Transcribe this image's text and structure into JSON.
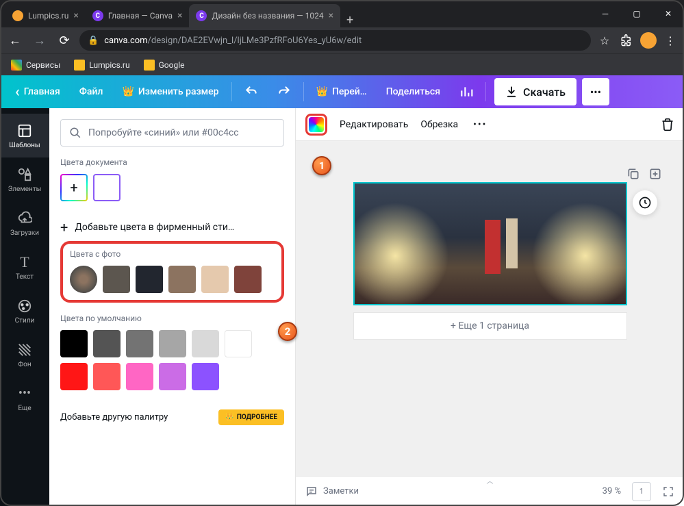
{
  "browser": {
    "tabs": [
      {
        "title": "Lumpics.ru",
        "favicon_color": "#f7a334"
      },
      {
        "title": "Главная — Canva",
        "favicon_bg": "#7c3aed",
        "favicon_text": "C"
      },
      {
        "title": "Дизайн без названия — 1024",
        "favicon_bg": "#7c3aed",
        "favicon_text": "C",
        "active": true
      }
    ],
    "url": {
      "lock": "🔒",
      "host": "canva.com",
      "path": "/design/DAE2EVwjn_l/ljLMe3PzfRFoU6Yes_yU6w/edit"
    },
    "bookmarks": [
      {
        "label": "Сервисы",
        "icon_html": "⋮⋮⋮"
      },
      {
        "label": "Lumpics.ru",
        "icon_color": "#fbbf24"
      },
      {
        "label": "Google",
        "icon_color": "#fbbf24"
      }
    ]
  },
  "topbar": {
    "back": "‹",
    "home": "Главная",
    "file": "Файл",
    "resize": "Изменить размер",
    "upgrade": "Перей…",
    "share": "Поделиться",
    "download": "Скачать"
  },
  "sidebar": [
    {
      "label": "Шаблоны",
      "icon": "templates",
      "active": true
    },
    {
      "label": "Элементы",
      "icon": "elements"
    },
    {
      "label": "Загрузки",
      "icon": "uploads"
    },
    {
      "label": "Текст",
      "icon": "text"
    },
    {
      "label": "Стили",
      "icon": "styles"
    },
    {
      "label": "Фон",
      "icon": "background"
    },
    {
      "label": "Еще",
      "icon": "more"
    }
  ],
  "color_panel": {
    "search_placeholder": "Попробуйте «синий» или #00c4cc",
    "doc_colors_label": "Цвета документа",
    "brand_colors": "Добавьте цвета в фирменный сти…",
    "photo_colors_label": "Цвета с фото",
    "photo_swatches": [
      "#5c564f",
      "#22262f",
      "#8c7360",
      "#e5c9ad",
      "#7f433b"
    ],
    "default_colors_label": "Цвета по умолчанию",
    "default_row1": [
      "#000000",
      "#545454",
      "#737373",
      "#a6a6a6",
      "#d9d9d9",
      "#ffffff"
    ],
    "default_row2": [
      "#ff1616",
      "#ff5757",
      "#ff66c4",
      "#cb6ce6",
      "#8c52ff"
    ],
    "add_palette": "Добавьте другую палитру",
    "detail_btn": "ПОДРОБНЕЕ"
  },
  "context_bar": {
    "edit": "Редактировать",
    "crop": "Обрезка"
  },
  "canvas": {
    "add_page": "+ Еще 1 страница"
  },
  "bottom": {
    "notes": "Заметки",
    "zoom": "39 %",
    "page": "1"
  },
  "callouts": {
    "one": "1",
    "two": "2"
  }
}
